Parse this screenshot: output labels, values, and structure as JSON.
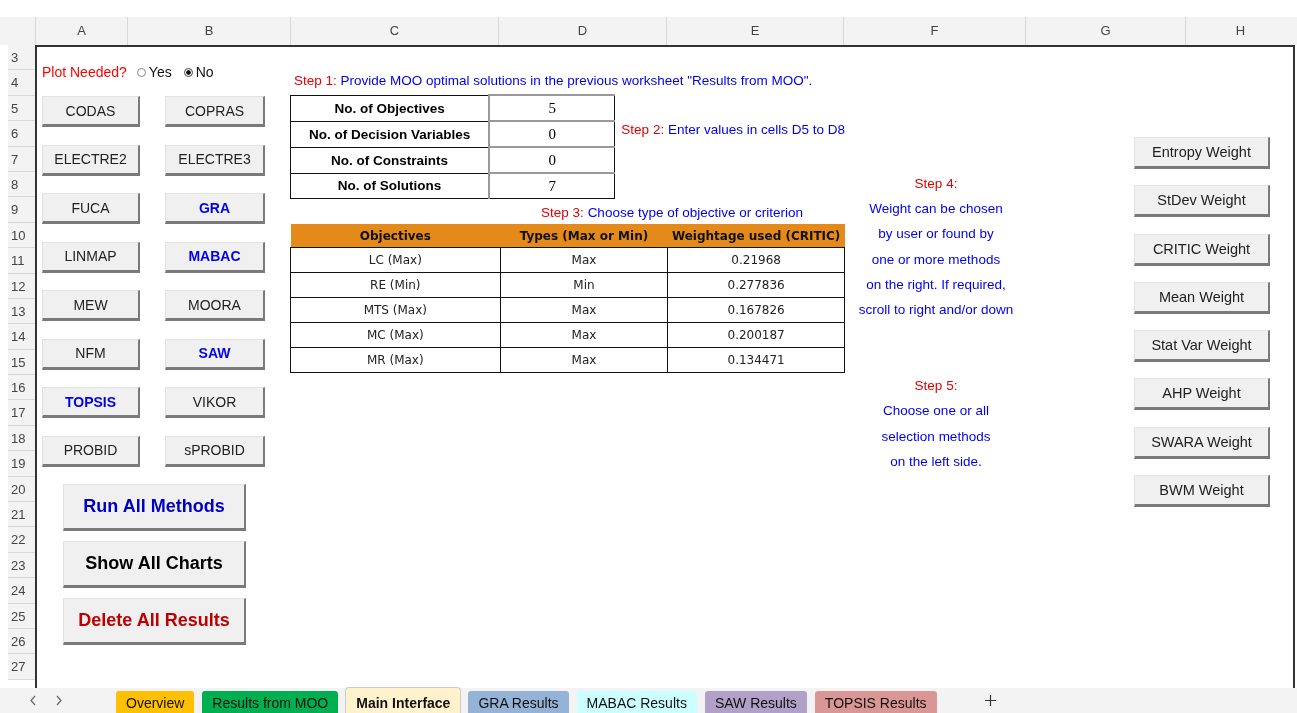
{
  "column_headers": [
    "A",
    "B",
    "C",
    "D",
    "E",
    "F",
    "G",
    "H"
  ],
  "row_numbers": [
    "3",
    "4",
    "5",
    "6",
    "7",
    "8",
    "9",
    "10",
    "11",
    "12",
    "13",
    "14",
    "15",
    "16",
    "17",
    "18",
    "19",
    "20",
    "21",
    "22",
    "23",
    "24",
    "25",
    "26",
    "27"
  ],
  "plot_option": {
    "label": "Plot Needed?",
    "options": [
      {
        "label": "Yes",
        "selected": false
      },
      {
        "label": "No",
        "selected": true
      }
    ]
  },
  "method_buttons": [
    {
      "label": "CODAS",
      "emphasis": false
    },
    {
      "label": "COPRAS",
      "emphasis": false
    },
    {
      "label": "ELECTRE2",
      "emphasis": false
    },
    {
      "label": "ELECTRE3",
      "emphasis": false
    },
    {
      "label": "FUCA",
      "emphasis": false
    },
    {
      "label": "GRA",
      "emphasis": true
    },
    {
      "label": "LINMAP",
      "emphasis": false
    },
    {
      "label": "MABAC",
      "emphasis": true
    },
    {
      "label": "MEW",
      "emphasis": false
    },
    {
      "label": "MOORA",
      "emphasis": false
    },
    {
      "label": "NFM",
      "emphasis": false
    },
    {
      "label": "SAW",
      "emphasis": true
    },
    {
      "label": "TOPSIS",
      "emphasis": true
    },
    {
      "label": "VIKOR",
      "emphasis": false
    },
    {
      "label": "PROBID",
      "emphasis": false
    },
    {
      "label": "sPROBID",
      "emphasis": false
    }
  ],
  "action_buttons": [
    {
      "label": "Run All Methods",
      "color": "#0000c0"
    },
    {
      "label": "Show All Charts",
      "color": "#000000"
    },
    {
      "label": "Delete All Results",
      "color": "#c00000"
    }
  ],
  "step1": {
    "label": "Step 1:",
    "text": "Provide MOO optimal solutions in the previous worksheet \"Results from MOO\"."
  },
  "inputs": [
    {
      "label": "No. of Objectives",
      "value": "5"
    },
    {
      "label": "No. of Decision Variables",
      "value": "0"
    },
    {
      "label": "No. of Constraints",
      "value": "0"
    },
    {
      "label": "No. of Solutions",
      "value": "7"
    }
  ],
  "step2": {
    "label": "Step 2:",
    "text": "Enter values in cells D5 to D8"
  },
  "step3": {
    "label": "Step 3:",
    "text": "Choose type of objective or criterion"
  },
  "objectives_table": {
    "columns": [
      "Objectives",
      "Types (Max or Min)",
      "Weightage used (CRITIC)"
    ],
    "rows": [
      [
        "LC (Max)",
        "Max",
        "0.21968"
      ],
      [
        "RE (Min)",
        "Min",
        "0.277836"
      ],
      [
        "MTS (Max)",
        "Max",
        "0.167826"
      ],
      [
        "MC (Max)",
        "Max",
        "0.200187"
      ],
      [
        "MR (Max)",
        "Max",
        "0.134471"
      ]
    ]
  },
  "step4": {
    "label": "Step 4:",
    "lines": [
      "Weight can be chosen",
      "by user or found by",
      "one or more methods",
      "on the right. If required,",
      "scroll to right and/or down"
    ]
  },
  "step5": {
    "label": "Step 5:",
    "lines": [
      "Choose one or all",
      "selection methods",
      "on the left side."
    ]
  },
  "weight_buttons": [
    "Entropy Weight",
    "StDev Weight",
    "CRITIC Weight",
    "Mean Weight",
    "Stat Var Weight",
    "AHP Weight",
    "SWARA Weight",
    "BWM Weight"
  ],
  "sheet_tabs": [
    {
      "label": "Overview",
      "color": "#ffc000",
      "selected": false
    },
    {
      "label": "Results from MOO",
      "color": "#00b050",
      "selected": false
    },
    {
      "label": "Main Interface",
      "color": "#fff2cc",
      "selected": true
    },
    {
      "label": "GRA Results",
      "color": "#95b3d7",
      "selected": false
    },
    {
      "label": "MABAC Results",
      "color": "#ccffff",
      "selected": false
    },
    {
      "label": "SAW Results",
      "color": "#b1a0c7",
      "selected": false
    },
    {
      "label": "TOPSIS Results",
      "color": "#da9694",
      "selected": false
    }
  ]
}
